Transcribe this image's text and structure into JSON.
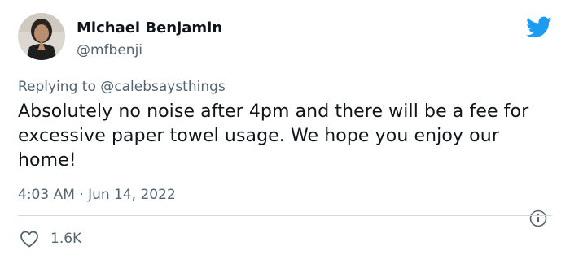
{
  "author": {
    "name": "Michael Benjamin",
    "handle": "@mfbenji"
  },
  "reply": {
    "prefix": "Replying to ",
    "target": "@calebsaysthings"
  },
  "tweet": {
    "text": "Absolutely no noise after 4pm and there will be a fee for excessive paper towel usage. We hope you enjoy our home!",
    "timestamp": "4:03 AM · Jun 14, 2022",
    "likes": "1.6K"
  },
  "icons": {
    "logo": "twitter-bird-icon",
    "info": "info-icon",
    "like": "heart-icon"
  },
  "colors": {
    "brand": "#1d9bf0",
    "text": "#0f1419",
    "secondary": "#536471",
    "divider": "#cfd9de"
  }
}
